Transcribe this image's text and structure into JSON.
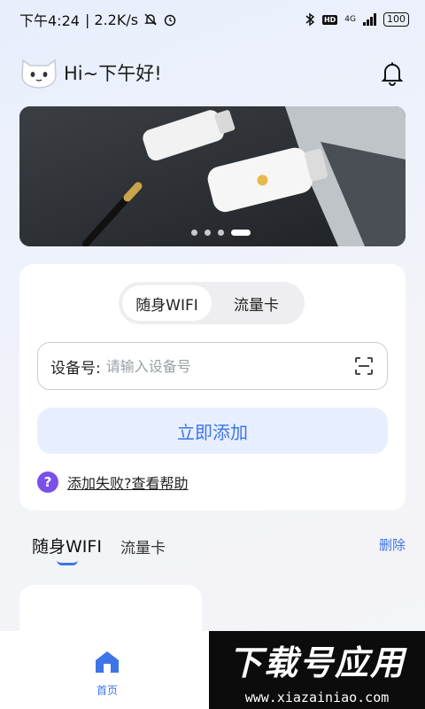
{
  "status_bar": {
    "time": "下午4:24",
    "speed": "| 2.2K/s",
    "network": "4G",
    "hd": "HD",
    "battery": "100"
  },
  "header": {
    "greeting": "Hi~下午好!"
  },
  "banner": {
    "dot_count": 4,
    "active_index": 3
  },
  "add_card": {
    "tabs": [
      "随身WIFI",
      "流量卡"
    ],
    "active_tab": 0,
    "device_label": "设备号:",
    "device_placeholder": "请输入设备号",
    "add_button": "立即添加",
    "help_icon": "?",
    "help_link": "添加失败?查看帮助"
  },
  "list": {
    "tab_active": "随身WIFI",
    "tab_other": "流量卡",
    "delete": "删除"
  },
  "bottom_nav": {
    "home_label": "首页"
  },
  "watermark": {
    "title": "下载号应用",
    "url": "www.xiazainiao.com"
  },
  "colors": {
    "accent": "#3d74e8",
    "help_icon": "#7b50e8"
  }
}
